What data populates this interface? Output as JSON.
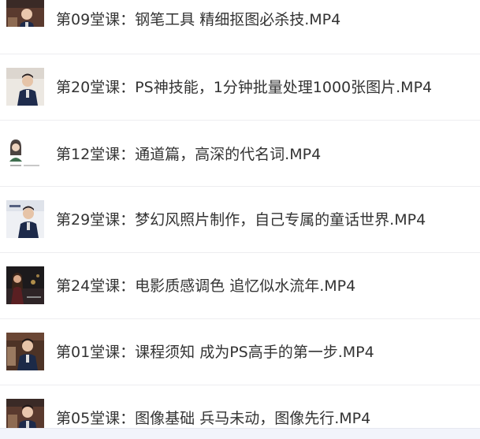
{
  "file_list": {
    "items": [
      {
        "name": "第09堂课：钢笔工具 精细抠图必杀技.MP4",
        "thumbnail_icon": "video-thumbnail-icon"
      },
      {
        "name": "第20堂课：PS神技能，1分钟批量处理1000张图片.MP4",
        "thumbnail_icon": "video-thumbnail-icon"
      },
      {
        "name": "第12堂课：通道篇，高深的代名词.MP4",
        "thumbnail_icon": "video-thumbnail-icon"
      },
      {
        "name": "第29堂课：梦幻风照片制作，自己专属的童话世界.MP4",
        "thumbnail_icon": "video-thumbnail-icon"
      },
      {
        "name": "第24堂课：电影质感调色 追忆似水流年.MP4",
        "thumbnail_icon": "video-thumbnail-icon"
      },
      {
        "name": "第01堂课：课程须知 成为PS高手的第一步.MP4",
        "thumbnail_icon": "video-thumbnail-icon"
      },
      {
        "name": "第05堂课：图像基础 兵马未动，图像先行.MP4",
        "thumbnail_icon": "video-thumbnail-icon"
      }
    ]
  },
  "colors": {
    "text": "#333333",
    "divider": "#ededf0",
    "bottom_strip": "#f2f4fb"
  }
}
